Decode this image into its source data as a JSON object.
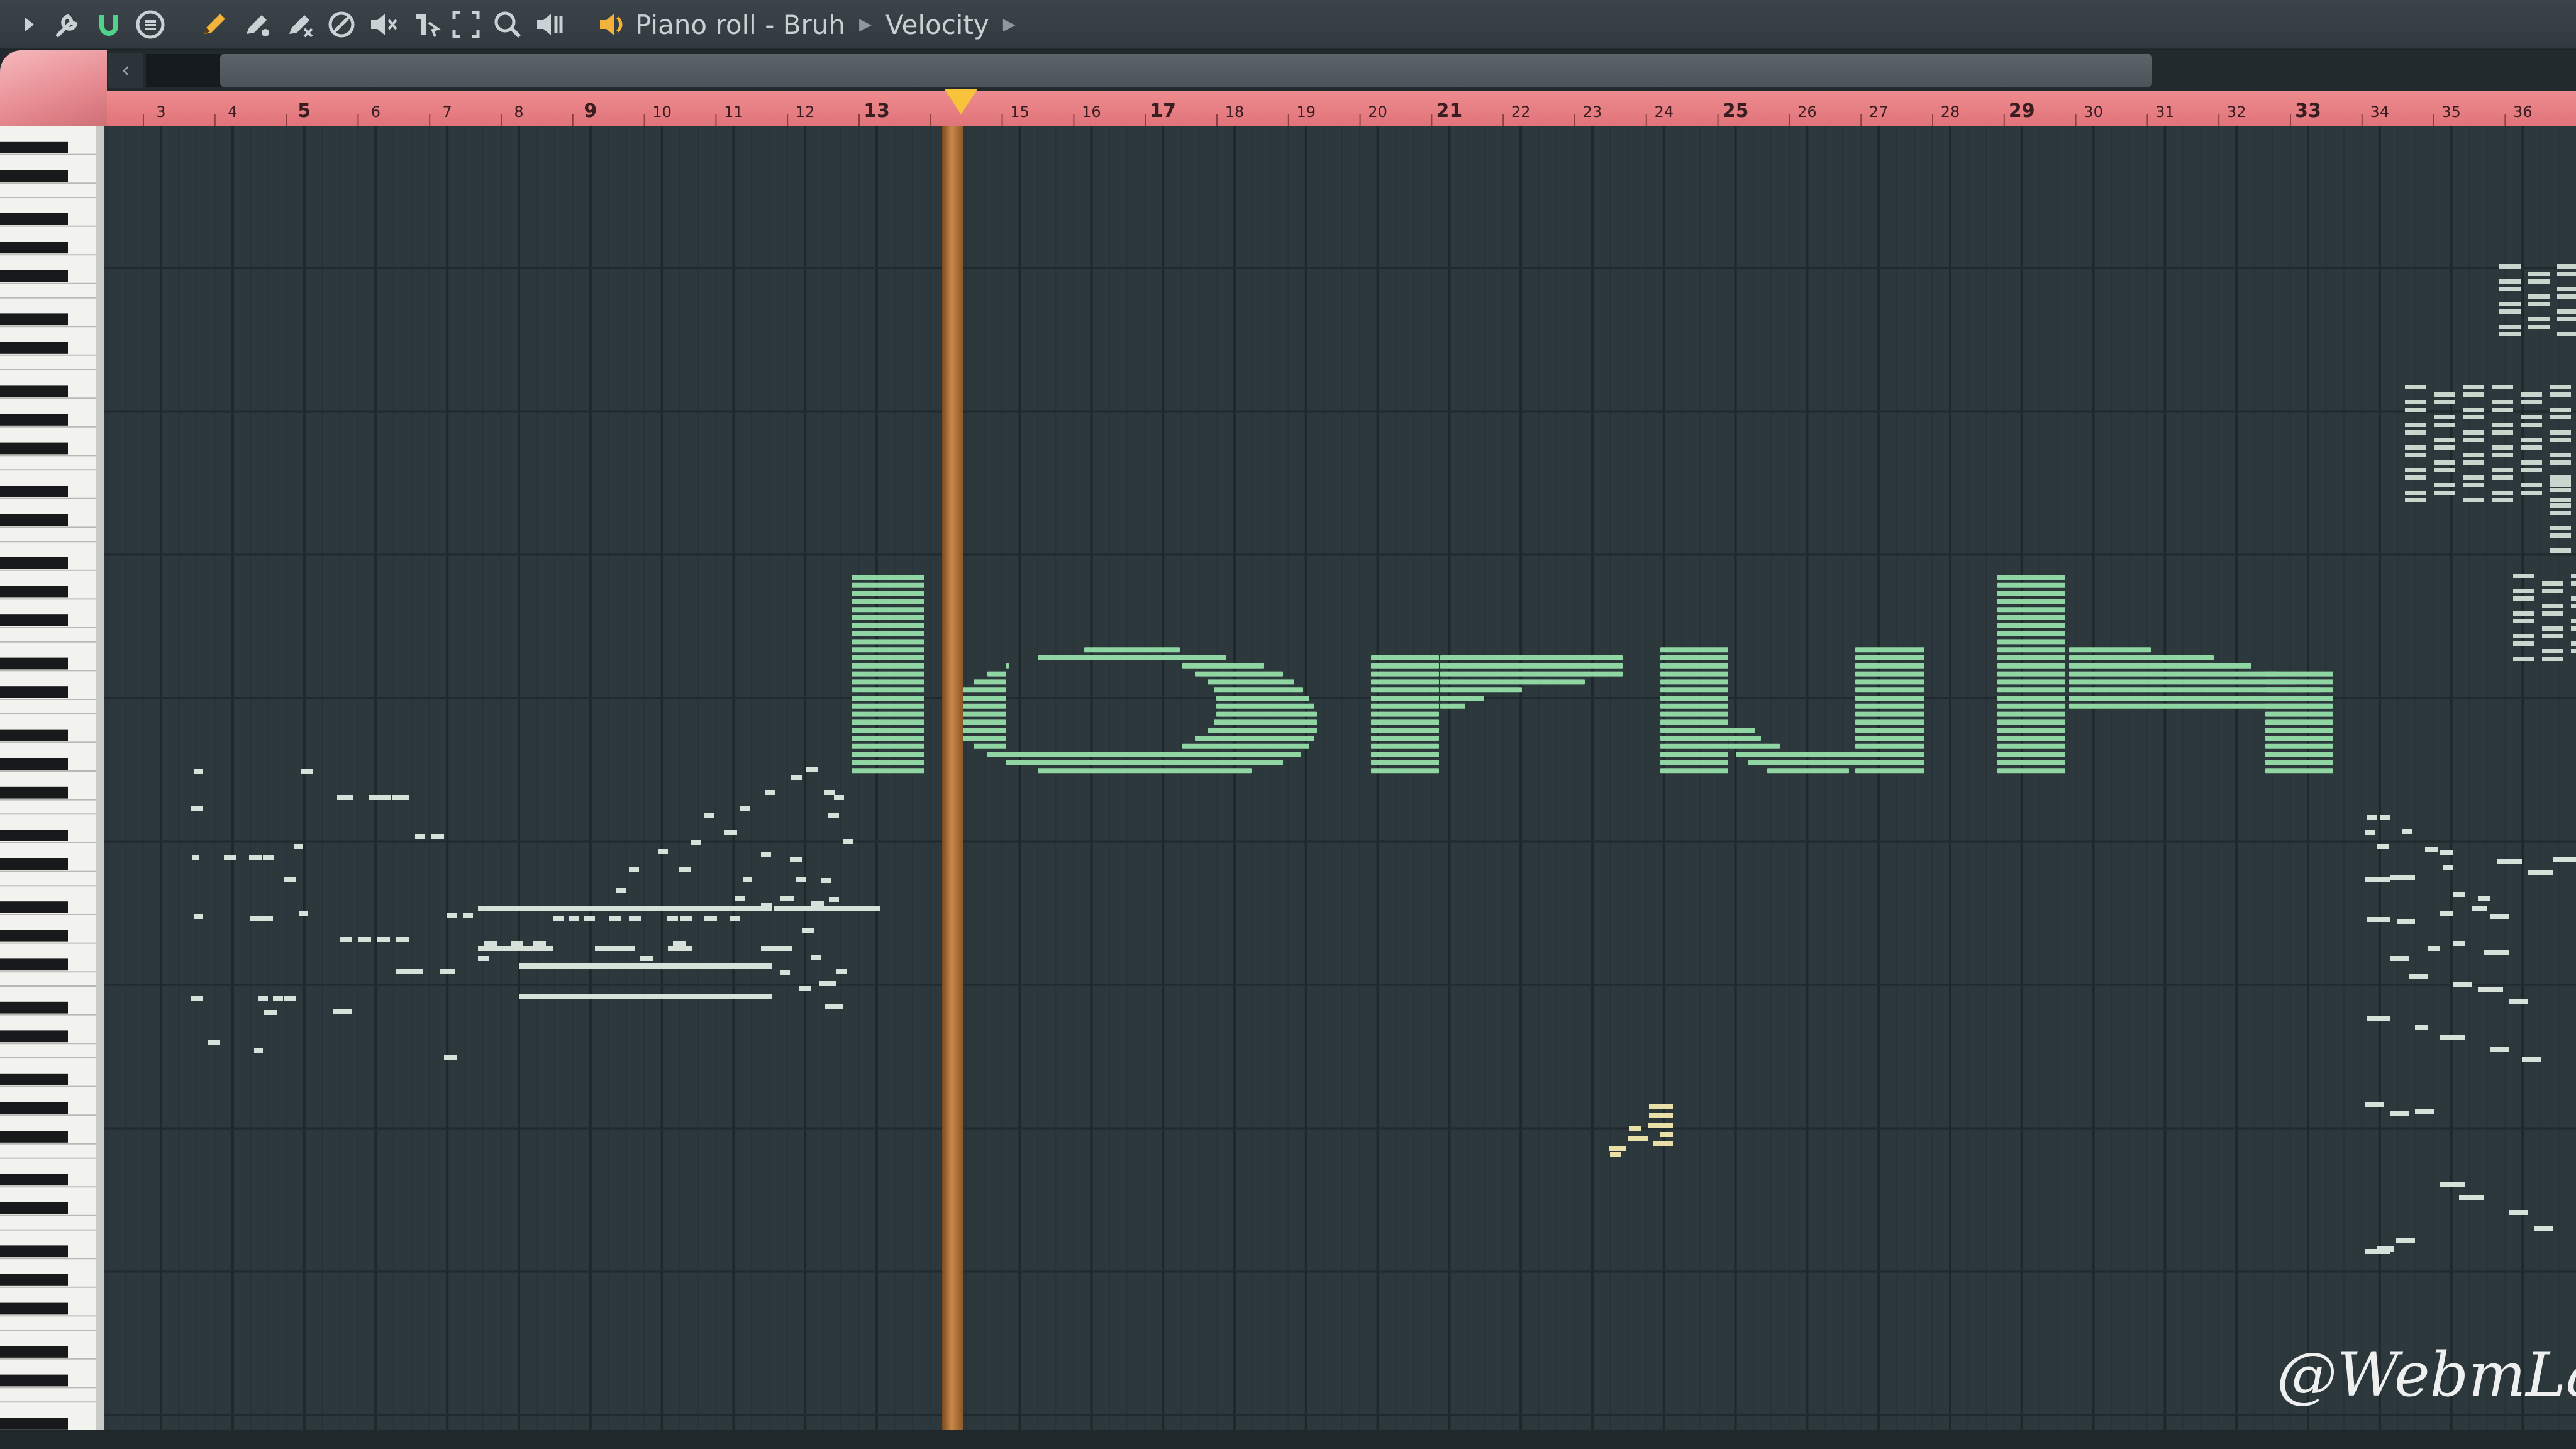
{
  "window": {
    "breadcrumb": [
      "Piano roll - Bruh",
      "Velocity"
    ],
    "accent": "#f6c33a"
  },
  "toolbar": {
    "icons": [
      "menu-arrow-icon",
      "wrench-icon",
      "magnet-icon",
      "options-icon",
      "pencil-icon",
      "paint-icon",
      "slice-icon",
      "delete-icon",
      "mute-icon",
      "slip-icon",
      "select-icon",
      "zoom-icon",
      "playback-icon",
      "speaker-icon"
    ]
  },
  "ruler": {
    "bar_labels": [
      "3",
      "4",
      "5",
      "6",
      "7",
      "8",
      "9",
      "10",
      "11",
      "12",
      "13",
      "14",
      "15",
      "16",
      "17",
      "18",
      "19",
      "20",
      "21",
      "22",
      "23",
      "24",
      "25",
      "26",
      "27",
      "28",
      "29",
      "30",
      "31",
      "32",
      "33",
      "34",
      "35",
      "36"
    ],
    "playhead_bar": 14,
    "color": "#e6777c"
  },
  "notes": {
    "main_text": "bruh",
    "note_color": "#8fd6a2",
    "marker_color": "#e8e0a6"
  },
  "watermark": "@WebmLand"
}
